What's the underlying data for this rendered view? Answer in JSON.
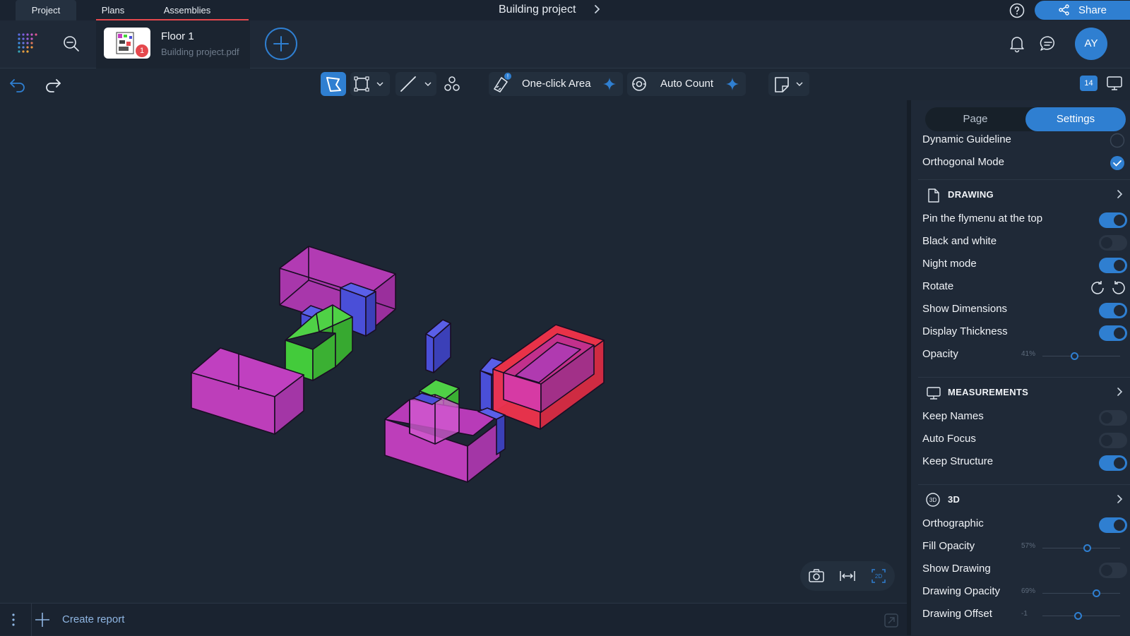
{
  "top_tabs": {
    "project": "Project",
    "plans": "Plans",
    "assemblies": "Assemblies"
  },
  "project_title": "Building project",
  "share_label": "Share",
  "plan": {
    "name": "Floor 1",
    "file": "Building project.pdf",
    "badge": "1"
  },
  "user_initials": "AY",
  "toolbar": {
    "one_click_area": "One-click Area",
    "auto_count": "Auto Count",
    "layers_count": "14"
  },
  "bottom": {
    "create_report": "Create report"
  },
  "panel": {
    "tabs": {
      "page": "Page",
      "settings": "Settings"
    },
    "top_rows": [
      {
        "label": "Dynamic Guideline",
        "control": "check",
        "checked": false
      },
      {
        "label": "Orthogonal Mode",
        "control": "check",
        "checked": true
      }
    ],
    "sections": [
      {
        "title": "DRAWING",
        "icon": "page-icon",
        "rows": [
          {
            "label": "Pin the flymenu at the top",
            "control": "toggle",
            "on": true
          },
          {
            "label": "Black and white",
            "control": "toggle",
            "on": false
          },
          {
            "label": "Night mode",
            "control": "toggle",
            "on": true
          },
          {
            "label": "Rotate",
            "control": "rotate"
          },
          {
            "label": "Show Dimensions",
            "control": "toggle",
            "on": true
          },
          {
            "label": "Display Thickness",
            "control": "toggle",
            "on": true
          },
          {
            "label": "Opacity",
            "control": "slider",
            "value_label": "41%",
            "value": 0.41
          }
        ]
      },
      {
        "title": "MEASUREMENTS",
        "icon": "monitor-icon",
        "rows": [
          {
            "label": "Keep Names",
            "control": "toggle",
            "on": false
          },
          {
            "label": "Auto Focus",
            "control": "toggle",
            "on": false
          },
          {
            "label": "Keep Structure",
            "control": "toggle",
            "on": true
          }
        ]
      },
      {
        "title": "3D",
        "icon": "3d-icon",
        "rows": [
          {
            "label": "Orthographic",
            "control": "toggle",
            "on": true
          },
          {
            "label": "Fill Opacity",
            "control": "slider",
            "value_label": "57%",
            "value": 0.57
          },
          {
            "label": "Show Drawing",
            "control": "toggle",
            "on": false
          },
          {
            "label": "Drawing Opacity",
            "control": "slider",
            "value_label": "69%",
            "value": 0.69
          },
          {
            "label": "Drawing Offset",
            "control": "slider",
            "value_label": "-1",
            "value": 0.45
          }
        ]
      }
    ]
  },
  "colors": {
    "accent": "#2f7fd1",
    "alert": "#e5484d",
    "magenta": "#c63fc2",
    "green": "#46d43c",
    "blue": "#4a4fd8",
    "red": "#f0334d"
  }
}
